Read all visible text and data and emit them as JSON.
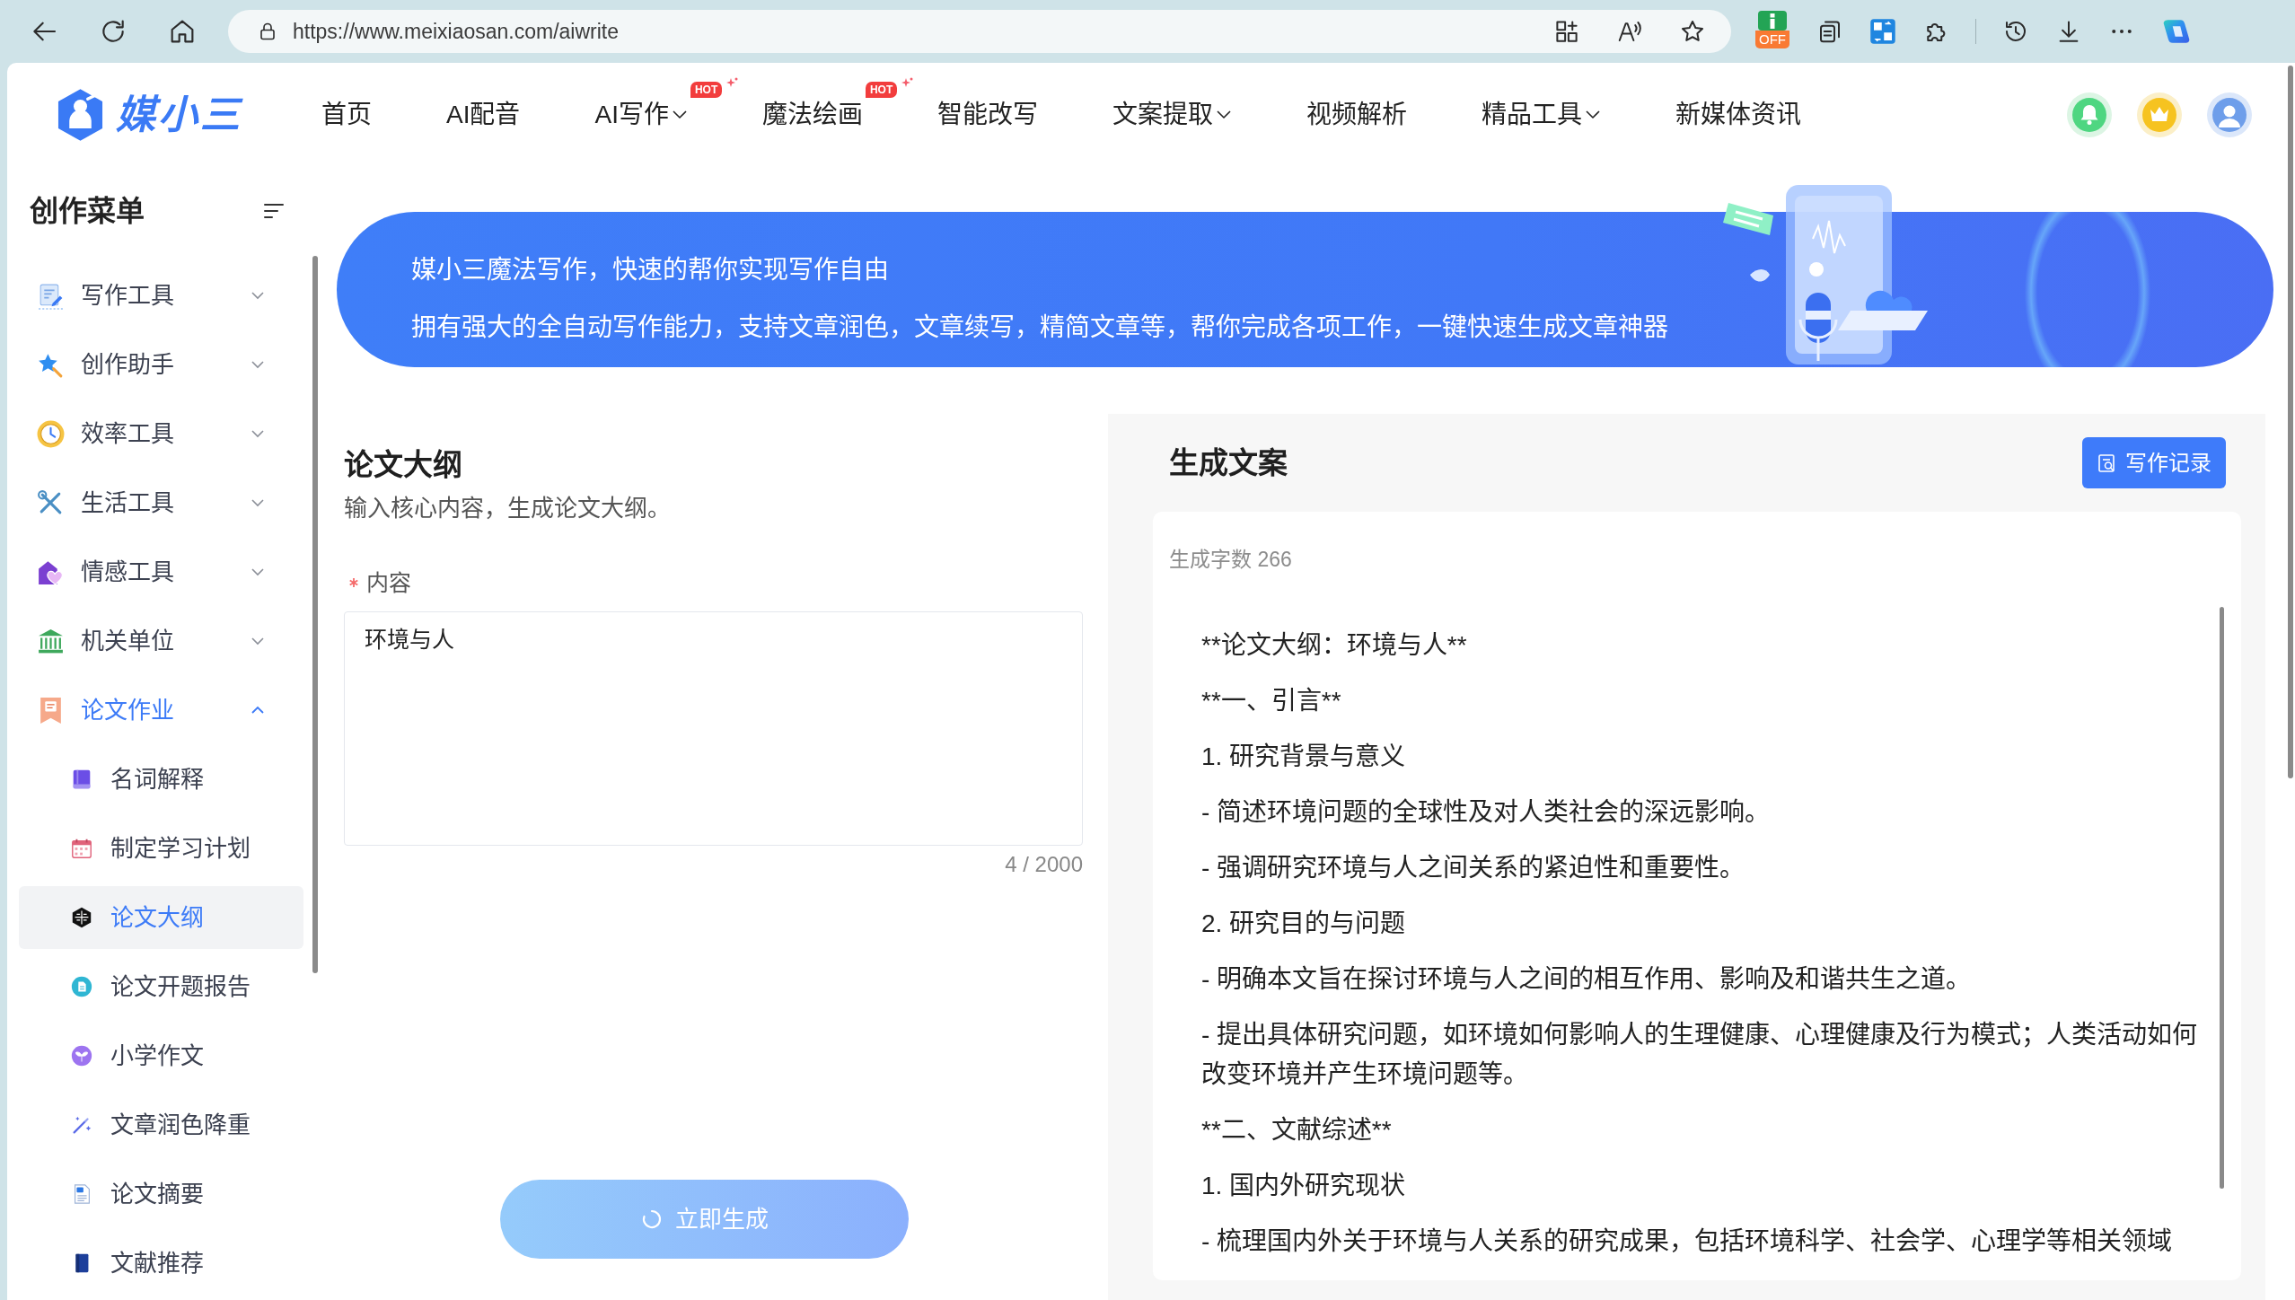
{
  "browser": {
    "url": "https://www.meixiaosan.com/aiwrite",
    "extension_badge": "OFF"
  },
  "header": {
    "logo": "媒小三",
    "nav": [
      {
        "label": "首页",
        "dropdown": false
      },
      {
        "label": "AI配音",
        "dropdown": false
      },
      {
        "label": "AI写作",
        "dropdown": true,
        "badge": "HOT"
      },
      {
        "label": "魔法绘画",
        "dropdown": false,
        "badge": "HOT"
      },
      {
        "label": "智能改写",
        "dropdown": false
      },
      {
        "label": "文案提取",
        "dropdown": true
      },
      {
        "label": "视频解析",
        "dropdown": false
      },
      {
        "label": "精品工具",
        "dropdown": true
      },
      {
        "label": "新媒体资讯",
        "dropdown": false
      }
    ]
  },
  "sidebar": {
    "title": "创作菜单",
    "items": [
      {
        "label": "写作工具",
        "expanded": false
      },
      {
        "label": "创作助手",
        "expanded": false
      },
      {
        "label": "效率工具",
        "expanded": false
      },
      {
        "label": "生活工具",
        "expanded": false
      },
      {
        "label": "情感工具",
        "expanded": false
      },
      {
        "label": "机关单位",
        "expanded": false
      },
      {
        "label": "论文作业",
        "expanded": true,
        "children": [
          {
            "label": "名词解释",
            "selected": false
          },
          {
            "label": "制定学习计划",
            "selected": false
          },
          {
            "label": "论文大纲",
            "selected": true
          },
          {
            "label": "论文开题报告",
            "selected": false
          },
          {
            "label": "小学作文",
            "selected": false
          },
          {
            "label": "文章润色降重",
            "selected": false
          },
          {
            "label": "论文摘要",
            "selected": false
          },
          {
            "label": "文献推荐",
            "selected": false
          }
        ]
      }
    ]
  },
  "banner": {
    "title": "媒小三魔法写作，快速的帮你实现写作自由",
    "text": "拥有强大的全自动写作能力，支持文章润色，文章续写，精简文章等，帮你完成各项工作，一键快速生成文章神器"
  },
  "form": {
    "title": "论文大纲",
    "subtitle": "输入核心内容，生成论文大纲。",
    "field": {
      "label": "内容",
      "required": true,
      "value": "环境与人",
      "counter": "4 / 2000"
    },
    "submit": {
      "label": "立即生成",
      "loading": true
    }
  },
  "output": {
    "title": "生成文案",
    "history_button": "写作记录",
    "word_count": "生成字数 266",
    "paragraphs": [
      "**论文大纲：环境与人**",
      "**一、引言**",
      "1. 研究背景与意义",
      "- 简述环境问题的全球性及对人类社会的深远影响。",
      "- 强调研究环境与人之间关系的紧迫性和重要性。",
      "2. 研究目的与问题",
      "- 明确本文旨在探讨环境与人之间的相互作用、影响及和谐共生之道。",
      "- 提出具体研究问题，如环境如何影响人的生理健康、心理健康及行为模式；人类活动如何改变环境并产生环境问题等。",
      "**二、文献综述**",
      "1. 国内外研究现状",
      "- 梳理国内外关于环境与人关系的研究成果，包括环境科学、社会学、心理学等相关领域"
    ]
  }
}
